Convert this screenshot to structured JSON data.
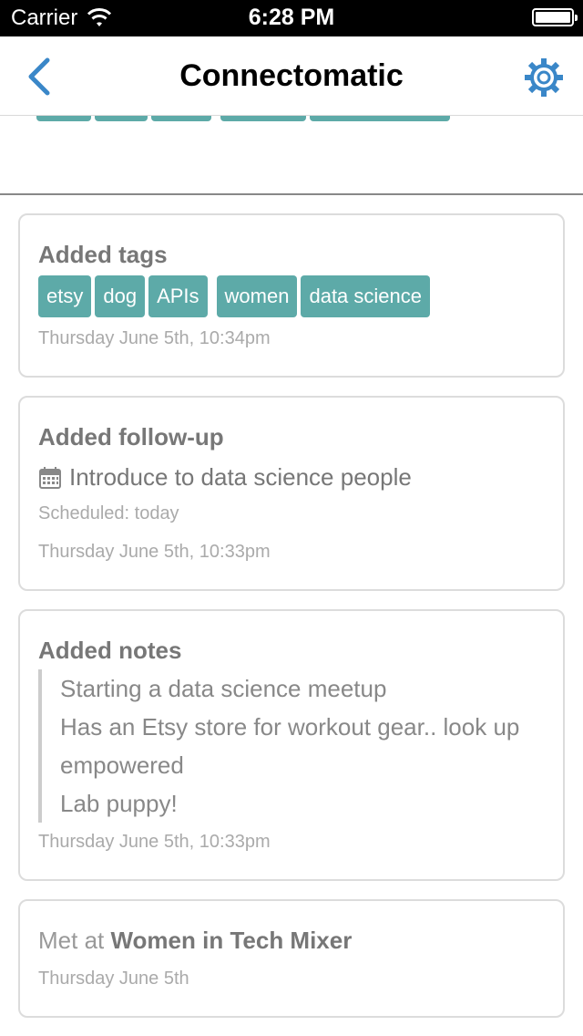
{
  "status_bar": {
    "carrier": "Carrier",
    "time": "6:28 PM"
  },
  "nav": {
    "title": "Connectomatic"
  },
  "cards": {
    "tags_card": {
      "title": "Added tags",
      "tags": [
        "etsy",
        "dog",
        "APIs",
        "women",
        "data science"
      ],
      "timestamp": "Thursday June 5th, 10:34pm"
    },
    "followup_card": {
      "title": "Added follow-up",
      "text": "Introduce to data science people",
      "scheduled": "Scheduled: today",
      "timestamp": "Thursday June 5th, 10:33pm"
    },
    "notes_card": {
      "title": "Added notes",
      "lines": [
        "Starting a data science meetup",
        "Has an Etsy store for workout gear.. look up",
        "empowered",
        "Lab puppy!"
      ],
      "timestamp": "Thursday June 5th, 10:33pm"
    },
    "met_card": {
      "prefix": "Met at",
      "event": "Women in Tech Mixer",
      "timestamp": "Thursday June 5th"
    }
  },
  "colors": {
    "accent": "#3a87c8",
    "tag": "#5daaa8"
  }
}
